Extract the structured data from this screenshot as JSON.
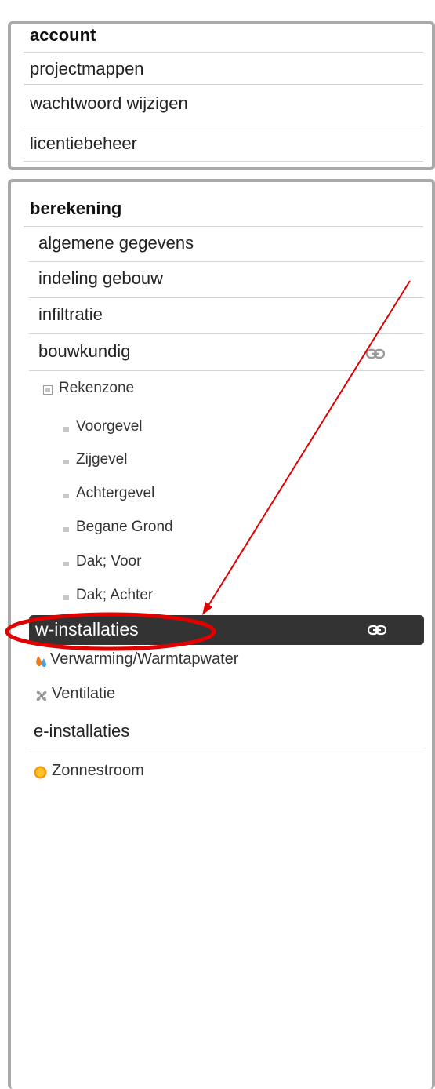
{
  "account": {
    "title": "account",
    "items": [
      {
        "label": "projectmappen"
      },
      {
        "label": "wachtwoord wijzigen"
      },
      {
        "label": "licentiebeheer"
      }
    ]
  },
  "berekening": {
    "title": "berekening",
    "items": [
      {
        "label": "algemene gegevens"
      },
      {
        "label": "indeling gebouw"
      },
      {
        "label": "infiltratie"
      },
      {
        "label": "bouwkundig",
        "icon": "link-icon"
      }
    ],
    "zone": {
      "label": "Rekenzone",
      "children": [
        "Voorgevel",
        "Zijgevel",
        "Achtergevel",
        "Begane Grond",
        "Dak; Voor",
        "Dak; Achter"
      ]
    },
    "w_installaties": {
      "label": "w-installaties",
      "icon": "link-icon",
      "selected": true,
      "children": [
        {
          "label": "Verwarming/Warmtapwater",
          "icon": "flame-drop-icon"
        },
        {
          "label": "Ventilatie",
          "icon": "fan-icon"
        }
      ]
    },
    "e_installaties": {
      "label": "e-installaties",
      "children": [
        {
          "label": "Zonnestroom",
          "icon": "sun-icon"
        }
      ]
    }
  },
  "annotation": {
    "highlight_color": "#e00000",
    "arrow_color": "#e00000"
  }
}
